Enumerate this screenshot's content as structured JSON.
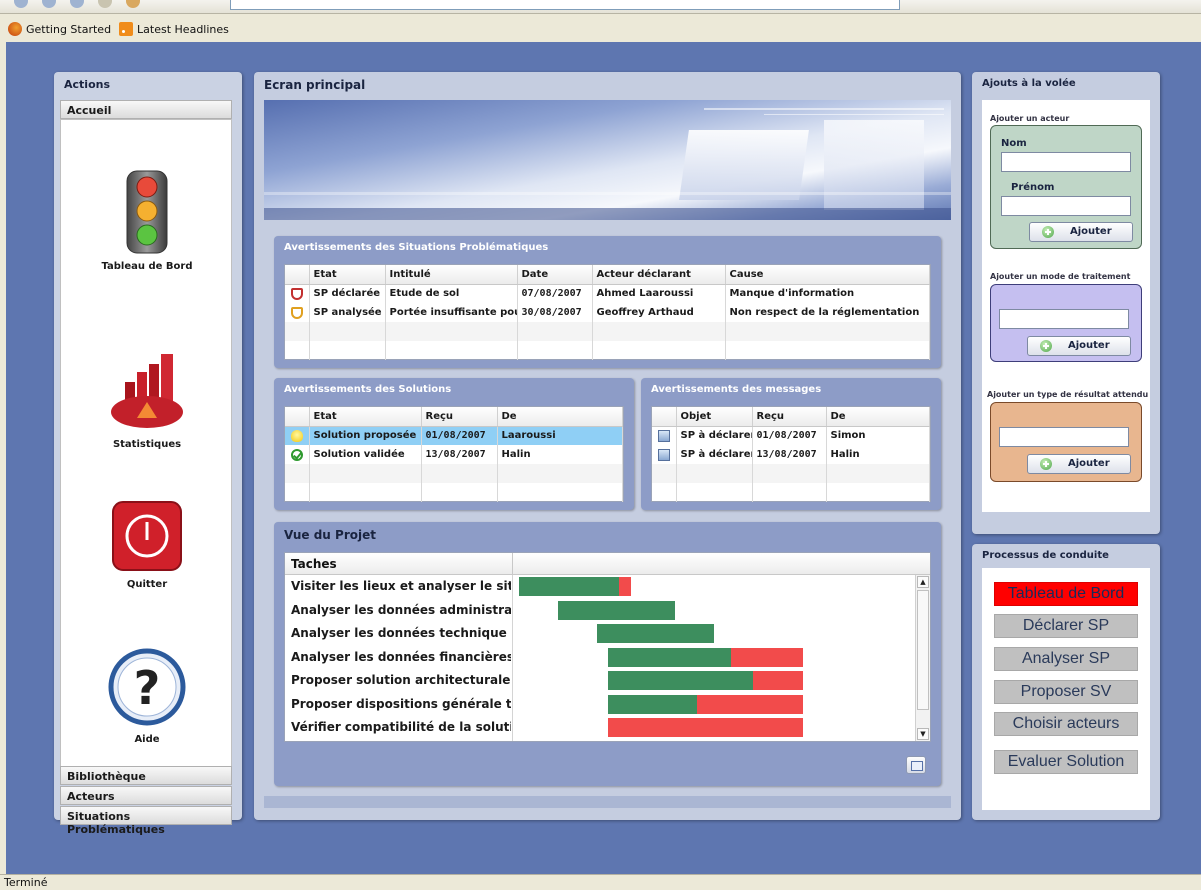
{
  "browser": {
    "bookmarks": [
      "Getting Started",
      "Latest Headlines"
    ],
    "status": "Terminé"
  },
  "actions": {
    "title": "Actions",
    "sections": {
      "accueil": "Accueil",
      "bibliotheque": "Bibliothèque",
      "acteurs": "Acteurs",
      "situations": "Situations Problématiques"
    },
    "tiles": [
      "Tableau de Bord",
      "Statistiques",
      "Quitter",
      "Aide"
    ]
  },
  "main": {
    "title": "Ecran principal",
    "sp": {
      "title": "Avertissements des Situations Problématiques",
      "columns": [
        "Etat",
        "Intitulé",
        "Date",
        "Acteur déclarant",
        "Cause"
      ],
      "rows": [
        {
          "etat": "SP déclarée",
          "intitule": "Etude de sol",
          "date": "07/08/2007",
          "acteur": "Ahmed Laaroussi",
          "cause": "Manque d'information"
        },
        {
          "etat": "SP analysée",
          "intitule": "Portée insuffisante pou",
          "date": "30/08/2007",
          "acteur": "Geoffrey Arthaud",
          "cause": "Non respect de la réglementation"
        }
      ]
    },
    "solutions": {
      "title": "Avertissements des Solutions",
      "columns": [
        "Etat",
        "Reçu",
        "De"
      ],
      "rows": [
        {
          "etat": "Solution proposée",
          "recu": "01/08/2007",
          "de": "Laaroussi"
        },
        {
          "etat": "Solution validée",
          "recu": "13/08/2007",
          "de": "Halin"
        }
      ]
    },
    "messages": {
      "title": "Avertissements des messages",
      "columns": [
        "Objet",
        "Reçu",
        "De"
      ],
      "rows": [
        {
          "objet": "SP à déclarer",
          "recu": "01/08/2007",
          "de": "Simon"
        },
        {
          "objet": "SP à déclarer",
          "recu": "13/08/2007",
          "de": "Halin"
        }
      ]
    },
    "projet": {
      "title": "Vue du Projet",
      "tasks_header": "Taches",
      "tasks": [
        {
          "name": "Visiter les lieux et analyser le site",
          "green": [
            0,
            0.18
          ],
          "red": [
            0.18,
            0.2
          ]
        },
        {
          "name": "Analyser les données administratives",
          "green": [
            0.07,
            0.28
          ],
          "red": null
        },
        {
          "name": "Analyser les données technique",
          "green": [
            0.14,
            0.35
          ],
          "red": null
        },
        {
          "name": "Analyser les données financières",
          "green": [
            0.16,
            0.38
          ],
          "red": [
            0.38,
            0.51
          ]
        },
        {
          "name": "Proposer solution architecturale",
          "green": [
            0.16,
            0.42
          ],
          "red": [
            0.42,
            0.51
          ]
        },
        {
          "name": "Proposer dispositions générale techniques",
          "green": [
            0.16,
            0.32
          ],
          "red": [
            0.32,
            0.51
          ]
        },
        {
          "name": "Vérifier compatibilité de la solution",
          "green": null,
          "red": [
            0.16,
            0.51
          ]
        }
      ]
    }
  },
  "ajouts": {
    "title": "Ajouts à la volée",
    "acteur": {
      "caption": "Ajouter un acteur",
      "nom": "Nom",
      "prenom": "Prénom",
      "button": "Ajouter",
      "color": "#bfd6c7"
    },
    "traitement": {
      "caption": "Ajouter un mode de traitement",
      "button": "Ajouter",
      "color": "#c5bff0"
    },
    "resultat": {
      "caption": "Ajouter un type de résultat attendu",
      "button": "Ajouter",
      "color": "#e8b68f"
    }
  },
  "processus": {
    "title": "Processus de conduite",
    "steps": [
      "Tableau de Bord",
      "Déclarer SP",
      "Analyser SP",
      "Proposer SV",
      "Choisir acteurs",
      "Evaluer Solution"
    ],
    "active_index": 0,
    "active_color": "#ff0000"
  }
}
